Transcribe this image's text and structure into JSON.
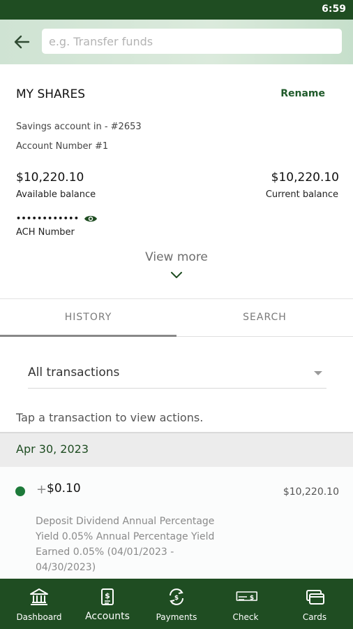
{
  "status_bar": {
    "time": "6:59"
  },
  "search": {
    "placeholder": "e.g. Transfer funds"
  },
  "account": {
    "name": "MY SHARES",
    "rename_label": "Rename",
    "type_line": "Savings account in - #2653",
    "number_line": "Account Number #1",
    "available_balance": "$10,220.10",
    "available_label": "Available balance",
    "current_balance": "$10,220.10",
    "current_label": "Current balance",
    "ach_masked": "••••••••••••",
    "ach_label": "ACH Number",
    "view_more": "View more"
  },
  "tabs": [
    {
      "label": "HISTORY",
      "active": true
    },
    {
      "label": "SEARCH",
      "active": false
    }
  ],
  "filter": {
    "selected": "All transactions"
  },
  "hint": "Tap a transaction to view actions.",
  "transactions": {
    "date_header": "Apr 30, 2023",
    "items": [
      {
        "sign": "+",
        "amount": "$0.10",
        "running_balance": "$10,220.10",
        "description": "Deposit Dividend Annual Percentage Yield 0.05% Annual Percentage Yield Earned 0.05% (04/01/2023 - 04/30/2023)"
      }
    ]
  },
  "bottom_nav": [
    {
      "label": "Dashboard",
      "icon": "bank-icon"
    },
    {
      "label": "Accounts",
      "icon": "document-dollar-icon"
    },
    {
      "label": "Payments",
      "icon": "payment-cycle-icon"
    },
    {
      "label": "Check",
      "icon": "check-icon"
    },
    {
      "label": "Cards",
      "icon": "cards-icon"
    }
  ],
  "colors": {
    "brand_green": "#1f4d22",
    "accent_green": "#1d7a3a",
    "date_text": "#1f4d22"
  }
}
